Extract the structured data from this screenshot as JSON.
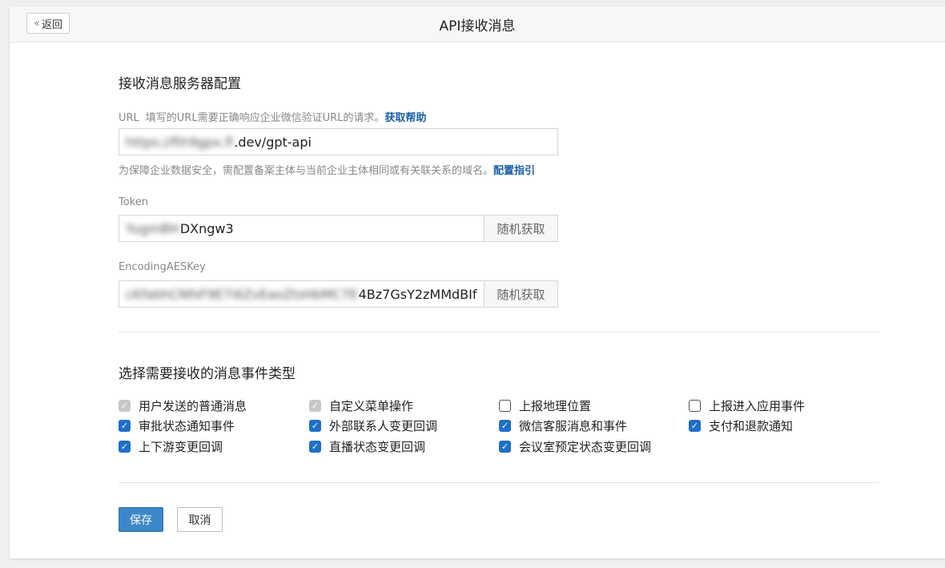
{
  "header": {
    "back_label": "返回",
    "title": "API接收消息"
  },
  "server_config": {
    "title": "接收消息服务器配置",
    "url": {
      "label": "URL",
      "hint": "填写的URL需要正确响应企业微信验证URL的请求。",
      "help_link": "获取帮助",
      "value_blurred": "https://fth9gpx.fl",
      "value_visible": ".dev/gpt-api",
      "note": "为保障企业数据安全，需配置备案主体与当前企业主体相同或有关联关系的域名。",
      "note_link": "配置指引"
    },
    "token": {
      "label": "Token",
      "value_blurred": "YugmBH",
      "value_visible": "DXngw3",
      "random_label": "随机获取"
    },
    "aes_key": {
      "label": "EncodingAESKey",
      "value_blurred": "cKfabhCNfsF9E7i6ZvEaoZtsHbMC7E",
      "value_visible": "4Bz7GsY2zMMdBIf",
      "random_label": "随机获取"
    }
  },
  "events": {
    "title": "选择需要接收的消息事件类型",
    "items": [
      {
        "label": "用户发送的普通消息",
        "state": "checked-disabled"
      },
      {
        "label": "自定义菜单操作",
        "state": "checked-disabled"
      },
      {
        "label": "上报地理位置",
        "state": "unchecked"
      },
      {
        "label": "上报进入应用事件",
        "state": "unchecked"
      },
      {
        "label": "审批状态通知事件",
        "state": "checked"
      },
      {
        "label": "外部联系人变更回调",
        "state": "checked"
      },
      {
        "label": "微信客服消息和事件",
        "state": "checked"
      },
      {
        "label": "支付和退款通知",
        "state": "checked"
      },
      {
        "label": "上下游变更回调",
        "state": "checked"
      },
      {
        "label": "直播状态变更回调",
        "state": "checked"
      },
      {
        "label": "会议室预定状态变更回调",
        "state": "checked"
      }
    ]
  },
  "actions": {
    "save_label": "保存",
    "cancel_label": "取消"
  },
  "colors": {
    "accent": "#1f6fc9",
    "link": "#1a5fa8",
    "save_button": "#3b87c8"
  }
}
